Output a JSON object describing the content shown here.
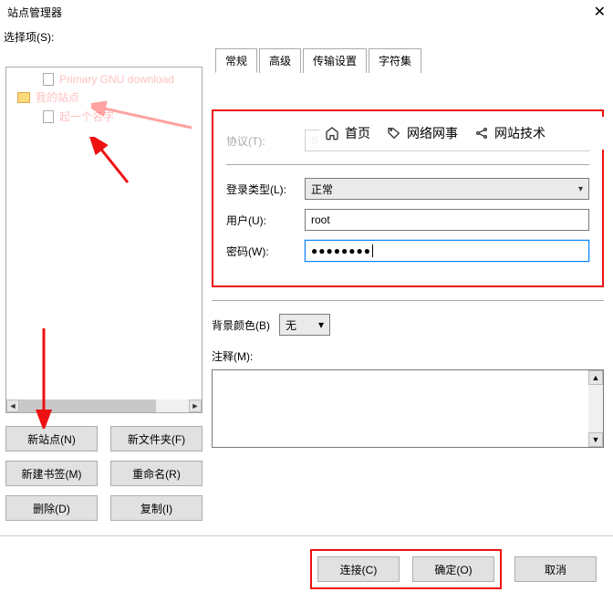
{
  "window": {
    "title": "站点管理器"
  },
  "select_label": "选择项(S):",
  "tabs": {
    "general": "常规",
    "advanced": "高级",
    "transfer": "传输设置",
    "charset": "字符集"
  },
  "tree": {
    "item_primary": "Primary GNU download",
    "item_mysite": "我的站点",
    "item_name": "起一个名字"
  },
  "left_buttons": {
    "new_site": "新站点(N)",
    "new_folder": "新文件夹(F)",
    "new_bookmark": "新建书签(M)",
    "rename": "重命名(R)",
    "delete": "删除(D)",
    "copy": "复制(I)"
  },
  "form": {
    "protocol_label": "协议(T):",
    "protocol_value_faded": "SF            File",
    "login_type_label": "登录类型(L):",
    "login_type_value": "正常",
    "user_label": "用户(U):",
    "user_value": "root",
    "password_label": "密码(W):",
    "password_value": "●●●●●●●●",
    "bg_color_label": "背景颜色(B)",
    "bg_color_value": "无",
    "notes_label": "注释(M):"
  },
  "overlay": {
    "home": "首页",
    "net": "网络网事",
    "tech": "网站技术"
  },
  "bottom": {
    "connect": "连接(C)",
    "ok": "确定(O)",
    "cancel": "取消"
  }
}
